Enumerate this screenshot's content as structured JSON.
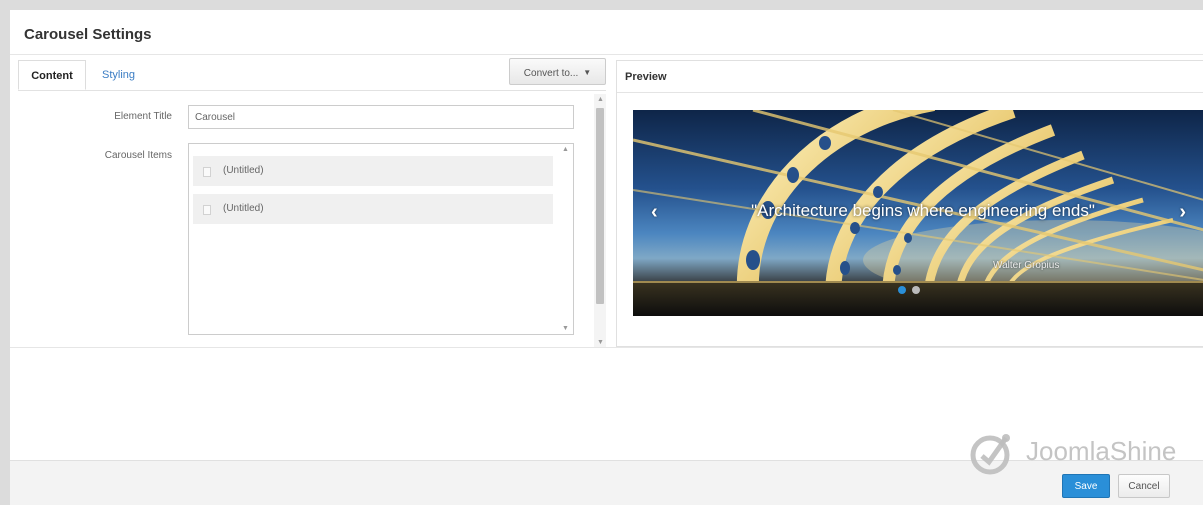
{
  "dialog": {
    "title": "Carousel Settings"
  },
  "tabs": [
    {
      "label": "Content",
      "active": true
    },
    {
      "label": "Styling",
      "active": false
    }
  ],
  "toolbar": {
    "convert_label": "Convert to...",
    "convert_icon": "caret-down-icon"
  },
  "form": {
    "element_title_label": "Element Title",
    "element_title_value": "Carousel",
    "carousel_items_label": "Carousel Items",
    "items": [
      {
        "label": "(Untitled)"
      },
      {
        "label": "(Untitled)"
      }
    ]
  },
  "preview": {
    "title": "Preview",
    "caption": "\"Architecture begins where engineering ends\"",
    "author": "Walter Gropius",
    "prev_glyph": "‹",
    "next_glyph": "›",
    "slides": 2,
    "active_slide": 1
  },
  "footer": {
    "save_label": "Save",
    "cancel_label": "Cancel",
    "watermark": "JoomlaShine"
  },
  "colors": {
    "accent": "#2a8fd8",
    "tab_link": "#3b7dc4",
    "dot_active": "#2a8fd8",
    "dot_inactive": "#bbbbbb"
  }
}
